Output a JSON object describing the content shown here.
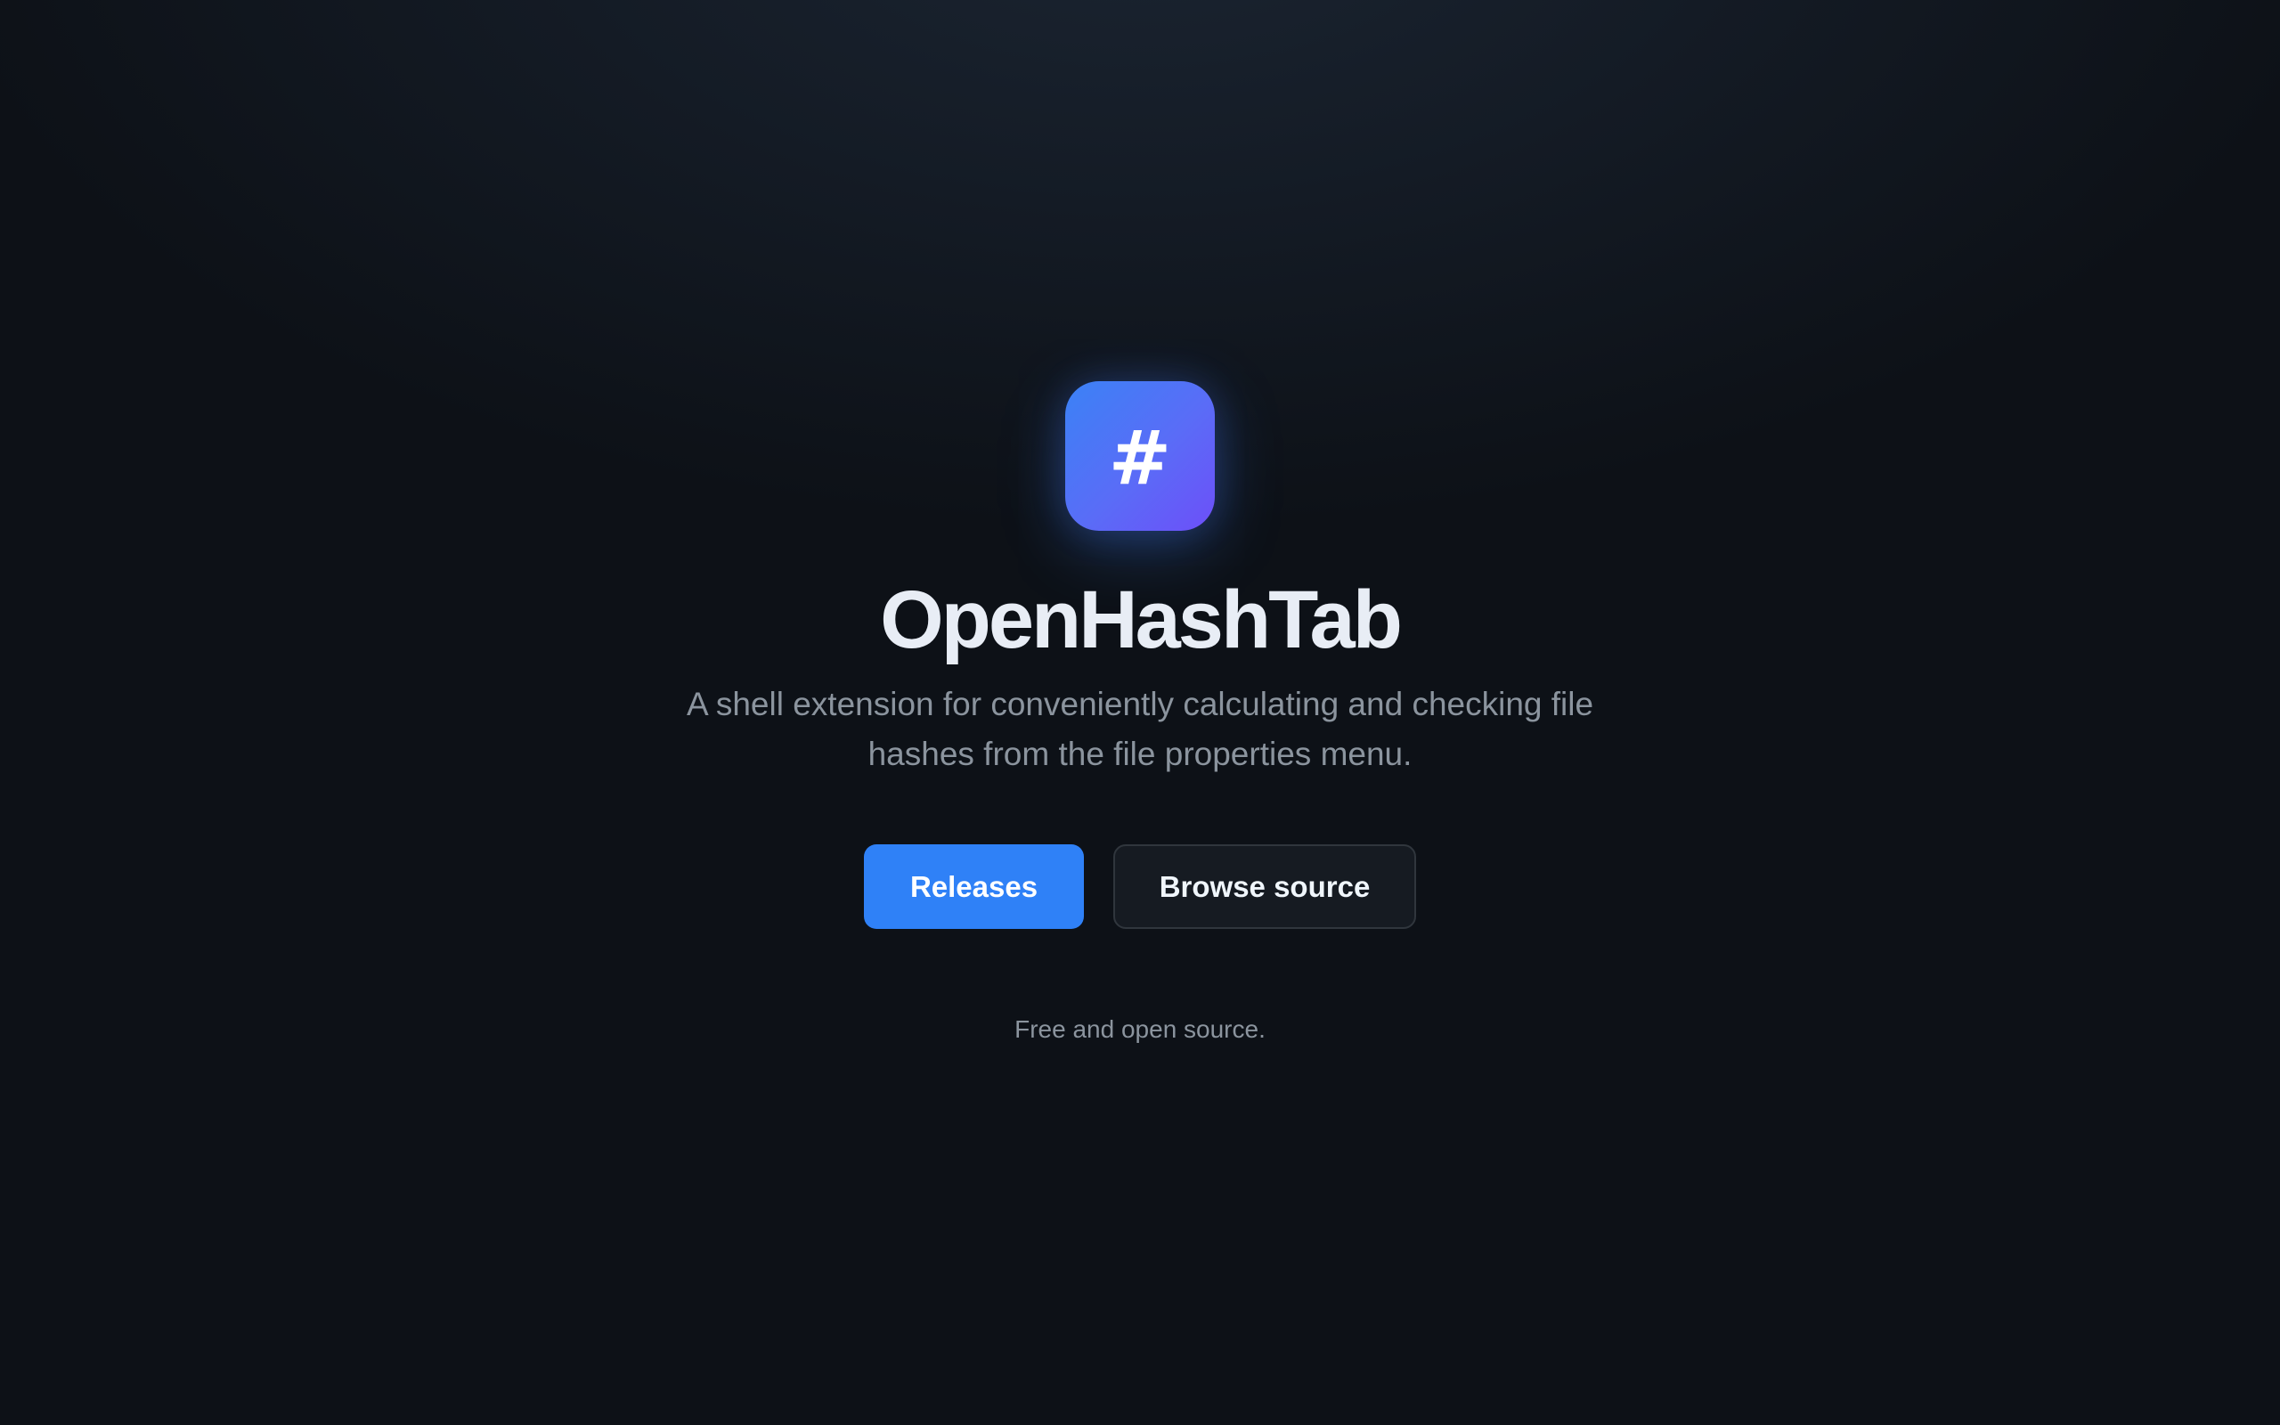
{
  "app": {
    "logo_glyph": "#",
    "logo_icon": "hash-icon",
    "title": "OpenHashTab",
    "subtitle": "A shell extension for conveniently calculating and checking file hashes from the file properties menu."
  },
  "actions": {
    "primary_label": "Releases",
    "secondary_label": "Browse source"
  },
  "footer": {
    "note": "Free and open source."
  },
  "colors": {
    "background": "#0d1117",
    "accent": "#2f81f7",
    "logo_gradient_start": "#3b82f6",
    "logo_gradient_end": "#6d4ff8",
    "muted_text": "#8b949e"
  }
}
